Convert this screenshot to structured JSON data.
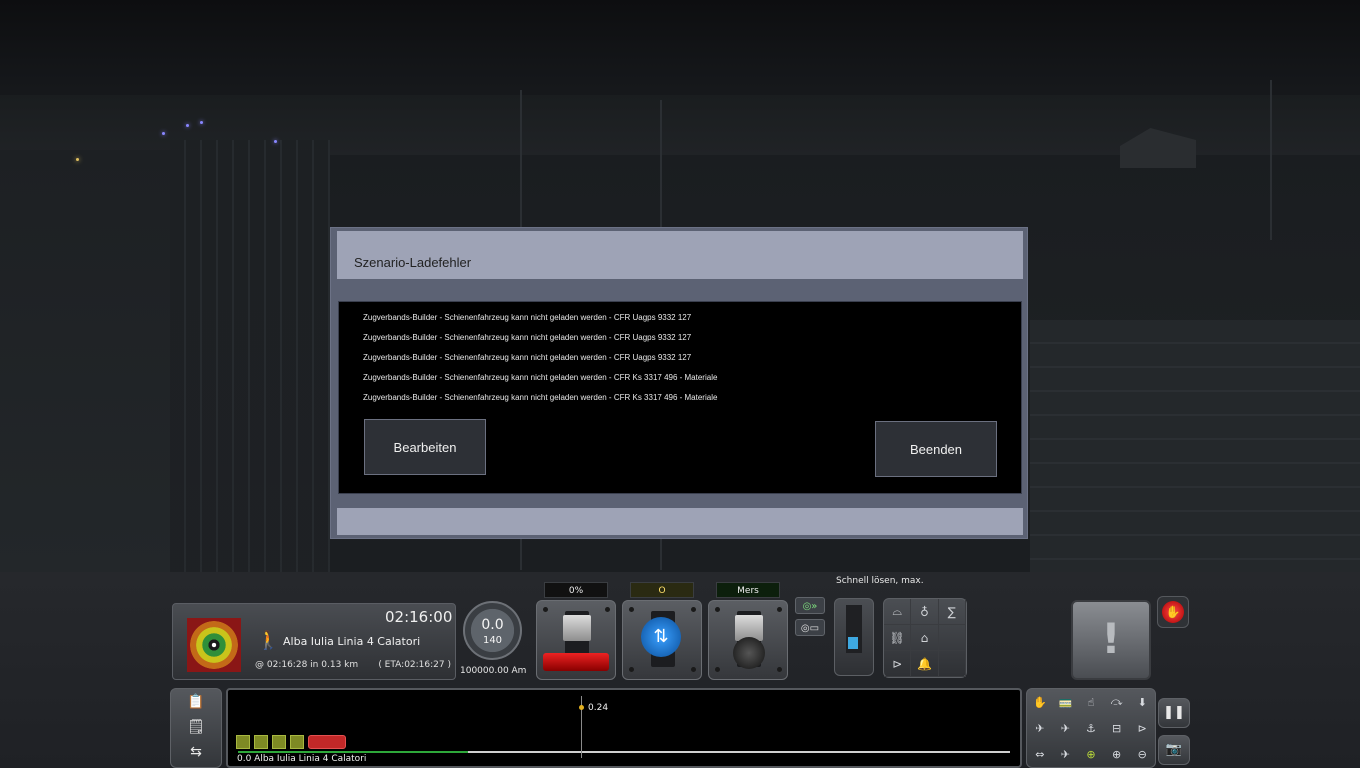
{
  "dialog": {
    "title": "Szenario-Ladefehler",
    "errors": [
      "Zugverbands-Builder - Schienenfahrzeug kann nicht geladen werden - CFR Uagps 9332 127",
      "Zugverbands-Builder - Schienenfahrzeug kann nicht geladen werden - CFR Uagps 9332 127",
      "Zugverbands-Builder - Schienenfahrzeug kann nicht geladen werden - CFR Uagps 9332 127",
      "Zugverbands-Builder - Schienenfahrzeug kann nicht geladen werden - CFR Ks 3317 496 - Materiale",
      "Zugverbands-Builder - Schienenfahrzeug kann nicht geladen werden - CFR Ks 3317 496 - Materiale"
    ],
    "edit_label": "Bearbeiten",
    "quit_label": "Beenden"
  },
  "hud": {
    "clock": "02:16:00",
    "destination": "Alba Iulia Linia 4 Calatori",
    "arrival_prefix": "@",
    "arrival_time": "02:16:28",
    "arrival_in": "in",
    "arrival_distance": "0.13 km",
    "eta": "( ETA:02:16:27 )",
    "speed": "0.0",
    "speed_limit": "140",
    "ammeter": "100000.00 Am",
    "throttle_label": "0%",
    "reverser_label": "O",
    "brake_label": "Mers",
    "brake_status": "Schnell lösen, max."
  },
  "track": {
    "marker_value": "0.24",
    "start_label": "0.0 Alba Iulia Linia 4 Calatori"
  },
  "icons": {
    "walker": "pedestrian-icon",
    "alert": "!",
    "stop": "hand-stop-icon",
    "pause": "pause-icon",
    "camera": "camera-icon"
  },
  "colors": {
    "dialog_frame": "#5c6274",
    "dialog_header": "#9ea3b6",
    "signal_red": "#991212",
    "track_progress": "#2ea83a"
  }
}
